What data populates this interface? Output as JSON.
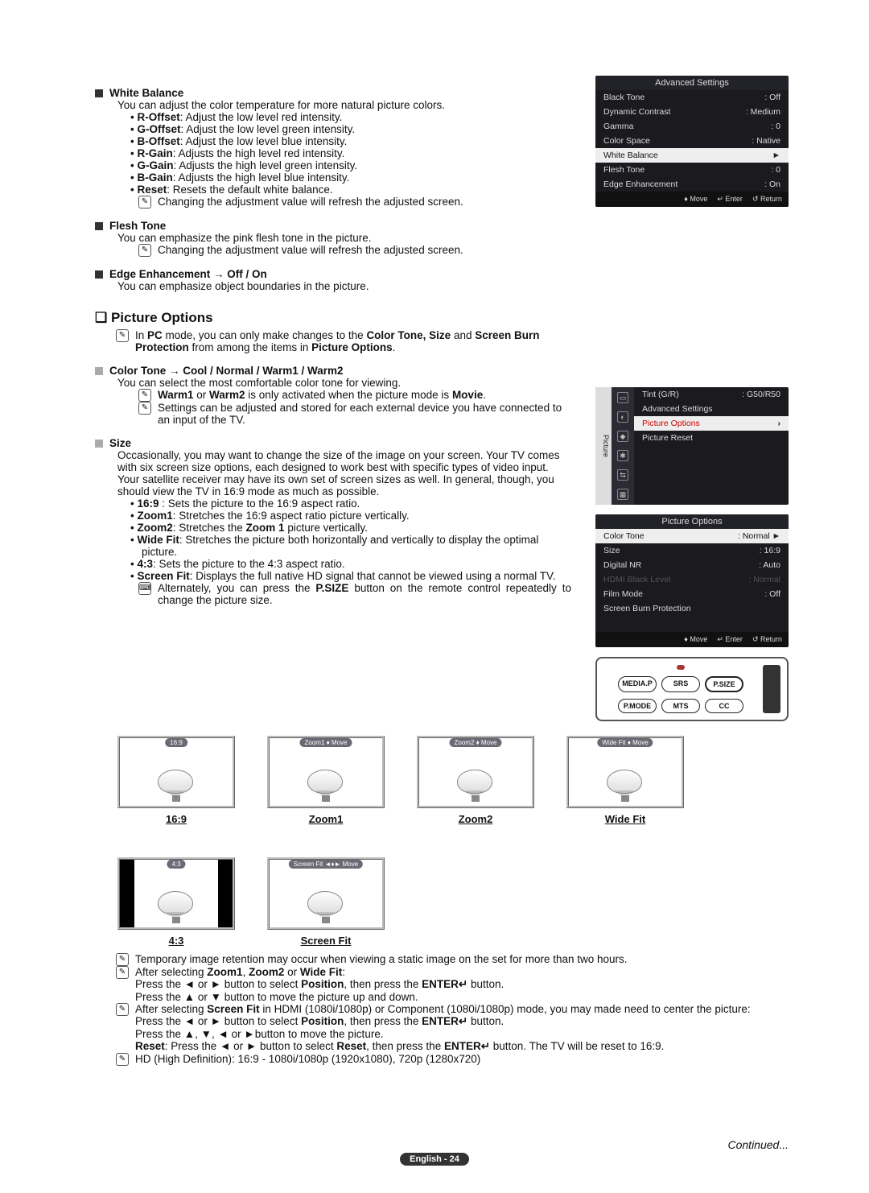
{
  "wb": {
    "title": "White Balance",
    "desc": "You can adjust the color temperature for more natural picture colors.",
    "items": [
      {
        "k": "R-Offset",
        "v": "Adjust the low level red intensity."
      },
      {
        "k": "G-Offset",
        "v": "Adjust the low level green intensity."
      },
      {
        "k": "B-Offset",
        "v": "Adjust the low level blue intensity."
      },
      {
        "k": "R-Gain",
        "v": "Adjusts the high level red intensity."
      },
      {
        "k": "G-Gain",
        "v": "Adjusts the high level green intensity."
      },
      {
        "k": "B-Gain",
        "v": "Adjusts the high level blue intensity."
      },
      {
        "k": "Reset",
        "v": "Resets the default white balance."
      }
    ],
    "note": "Changing the adjustment value will refresh the adjusted screen."
  },
  "flesh": {
    "title": "Flesh Tone",
    "desc": "You can emphasize the pink flesh tone in the picture.",
    "note": "Changing the adjustment value will refresh the adjusted screen."
  },
  "edge": {
    "title": "Edge Enhancement → Off / On",
    "desc": "You can emphasize object boundaries in the picture."
  },
  "po_title": "Picture Options",
  "po_note_a": "In ",
  "po_note_b": "PC",
  "po_note_c": " mode, you can only make changes to the ",
  "po_note_d": "Color Tone, Size",
  "po_note_e": " and ",
  "po_note_f": "Screen Burn Protection",
  "po_note_g": " from among the items in ",
  "po_note_h": "Picture Options",
  "po_note_i": ".",
  "ct": {
    "title": "Color Tone → Cool / Normal / Warm1 / Warm2",
    "desc": "You can select the most comfortable color tone for viewing.",
    "n1a": "Warm1",
    "n1b": " or ",
    "n1c": "Warm2",
    "n1d": " is only activated when the picture mode is ",
    "n1e": "Movie",
    "n1f": ".",
    "n2": "Settings can be adjusted and stored for each external device you have connected to an input of the TV."
  },
  "size": {
    "title": "Size",
    "desc": "Occasionally, you may want to change the size of the image on your screen. Your TV comes with six screen size options, each designed to work best with specific types of video input. Your satellite receiver may have its own set of screen sizes as well. In general, though, you should view the TV in 16:9 mode as much as possible.",
    "items": [
      {
        "k": "16:9",
        "v": " : Sets the picture to the 16:9 aspect ratio."
      },
      {
        "k": "Zoom1",
        "v": ": Stretches the 16:9 aspect ratio picture vertically."
      },
      {
        "k": "Zoom2",
        "v": ":  Stretches the ",
        "b": "Zoom 1",
        "v2": " picture vertically."
      },
      {
        "k": "Wide Fit",
        "v": ": Stretches the picture both horizontally and vertically to display the optimal picture."
      },
      {
        "k": "4:3",
        "v": ": Sets the picture to the 4:3 aspect ratio."
      },
      {
        "k": "Screen Fit",
        "v": ": Displays the full native HD signal that cannot be viewed using a normal TV."
      }
    ],
    "alt_a": "Alternately, you can press the ",
    "alt_b": "P.SIZE",
    "alt_c": " button on the remote control repeatedly to change the picture size."
  },
  "thumbs": [
    {
      "pill": "16:9",
      "label": "16:9",
      "narrow": false
    },
    {
      "pill": "Zoom1 ♦ Move",
      "label": "Zoom1",
      "narrow": false
    },
    {
      "pill": "Zoom2 ♦ Move",
      "label": "Zoom2",
      "narrow": false
    },
    {
      "pill": "Wide Fit ♦ Move",
      "label": "Wide Fit",
      "narrow": false
    },
    {
      "pill": "4:3",
      "label": "4:3",
      "narrow": true
    },
    {
      "pill": "Screen Fit ◄♦► Move",
      "label": "Screen Fit",
      "narrow": false
    }
  ],
  "bottom": {
    "n1": "Temporary image retention may occur when viewing a static image on the set for more than two hours.",
    "n2a": "After selecting ",
    "n2b": "Zoom1",
    "n2c": ", ",
    "n2d": "Zoom2",
    "n2e": " or ",
    "n2f": "Wide Fit",
    "n2g": ":",
    "n2l1a": "Press the ◄ or ► button to select ",
    "n2l1b": "Position",
    "n2l1c": ", then press the ",
    "n2l1e": " button.",
    "n2l2": "Press the ▲ or ▼ button to move the picture up and down.",
    "n3a": "After selecting ",
    "n3b": "Screen Fit",
    "n3c": " in HDMI (1080i/1080p) or Component (1080i/1080p) mode, you may made need to center the picture:",
    "n3l1a": "Press the ◄ or ► button to select ",
    "n3l1b": "Position",
    "n3l1c": ", then press the ",
    "n3l1e": " button.",
    "n3l2": "Press the ▲, ▼, ◄ or ►button to move the picture.",
    "n3l3a": "Reset",
    "n3l3b": ": Press the ◄ or ► button to select ",
    "n3l3c": "Reset",
    "n3l3d": ", then press the ",
    "n3l3f": " button. The TV will be reset to 16:9.",
    "n4": "HD (High Definition): 16:9 - 1080i/1080p (1920x1080), 720p (1280x720)"
  },
  "enter": "ENTER↵",
  "osd1": {
    "title": "Advanced Settings",
    "rows": [
      [
        "Black Tone",
        ": Off"
      ],
      [
        "Dynamic Contrast",
        ": Medium"
      ],
      [
        "Gamma",
        ": 0"
      ],
      [
        "Color Space",
        ": Native"
      ]
    ],
    "sel": [
      "White Balance",
      ""
    ],
    "rows2": [
      [
        "Flesh Tone",
        ": 0"
      ],
      [
        "Edge Enhancement",
        ": On"
      ]
    ],
    "foot": [
      "♦ Move",
      "↵ Enter",
      "↺ Return"
    ]
  },
  "osd2": {
    "side": "Picture",
    "top": [
      [
        "Tint (G/R)",
        ": G50/R50"
      ],
      [
        "Advanced Settings",
        ""
      ]
    ],
    "sel": [
      "Picture Options",
      "›"
    ],
    "rows": [
      [
        "Picture Reset",
        ""
      ]
    ]
  },
  "osd3": {
    "title": "Picture Options",
    "sel": [
      "Color Tone",
      ": Normal"
    ],
    "rows": [
      [
        "Size",
        ": 16:9"
      ],
      [
        "Digital NR",
        ": Auto"
      ]
    ],
    "dim": [
      "HDMI Black Level",
      ": Normal"
    ],
    "rows2": [
      [
        "Film Mode",
        ": Off"
      ],
      [
        "Screen Burn Protection",
        ""
      ]
    ],
    "foot": [
      "♦ Move",
      "↵ Enter",
      "↺ Return"
    ]
  },
  "remote": {
    "r1": [
      "MEDIA.P",
      "SRS",
      "P.SIZE"
    ],
    "r2": [
      "P.MODE",
      "MTS",
      "CC"
    ]
  },
  "continued": "Continued...",
  "footer": "English - 24"
}
